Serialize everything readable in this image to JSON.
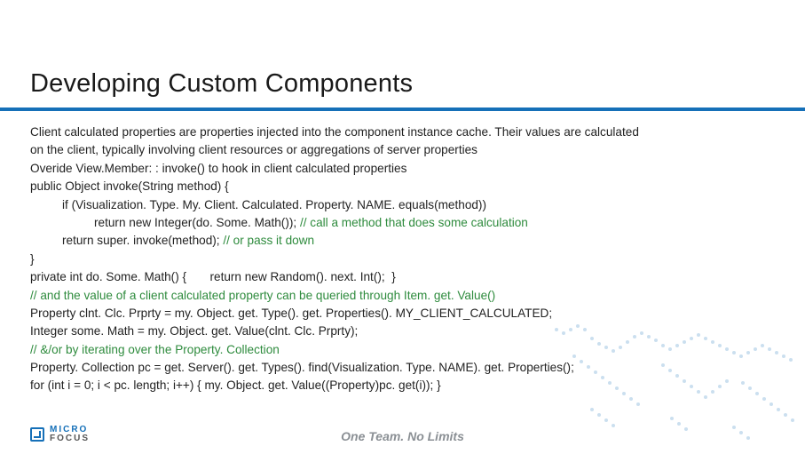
{
  "title": "Developing Custom Components",
  "body": {
    "intro1": "Client calculated properties are properties injected into the component instance cache. Their values are calculated",
    "intro2": "on the client, typically involving client resources or aggregations of server properties",
    "intro3": "Overide View.Member: : invoke() to hook in client calculated properties",
    "code1": "public Object invoke(String method) {",
    "code2": "if (Visualization. Type. My. Client. Calculated. Property. NAME. equals(method))",
    "code3a": "return new Integer(do. Some. Math()); ",
    "code3b": "// call a method that does some calculation",
    "code4a": "return super. invoke(method); ",
    "code4b": "// or pass it down",
    "code5": "}",
    "code6": "private int do. Some. Math() {       return new Random(). next. Int();  }",
    "comment7": "// and the value of a client calculated property can be queried through Item. get. Value()",
    "code8": "Property clnt. Clc. Prprty = my. Object. get. Type(). get. Properties(). MY_CLIENT_CALCULATED;",
    "code9": "Integer some. Math = my. Object. get. Value(clnt. Clc. Prprty);",
    "comment10": "// &/or by iterating over the Property. Collection",
    "code11": "Property. Collection pc = get. Server(). get. Types(). find(Visualization. Type. NAME). get. Properties();",
    "code12": "for (int i = 0; i < pc. length; i++) { my. Object. get. Value((Property)pc. get(i)); }"
  },
  "footer": {
    "logo_line1": "MICRO",
    "logo_line2": "FOCUS",
    "tagline": "One Team. No Limits"
  },
  "colors": {
    "rule": "#1670b8",
    "comment": "#2e8b3d",
    "tagline": "#8a8f94"
  }
}
